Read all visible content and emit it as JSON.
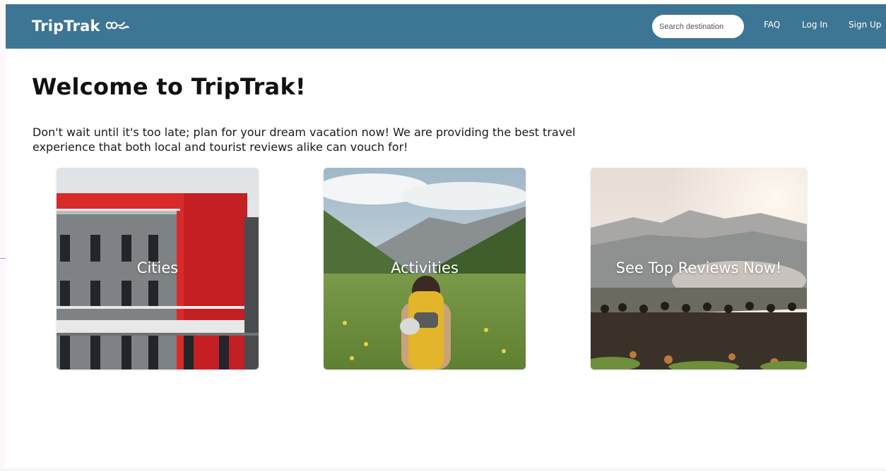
{
  "header": {
    "brand": "TripTrak",
    "search_placeholder": "Search destination",
    "nav": {
      "faq": "FAQ",
      "login": "Log In",
      "signup": "Sign Up"
    }
  },
  "main": {
    "title": "Welcome to TripTrak!",
    "intro": "Don't wait until it's too late; plan for your dream vacation now! We are providing the best travel experience that both local and tourist reviews alike can vouch for!",
    "cards": [
      {
        "label": "Cities"
      },
      {
        "label": "Activities"
      },
      {
        "label": "See Top Reviews Now!"
      }
    ]
  },
  "colors": {
    "navbar": "#3d7594",
    "text": "#111111",
    "background": "#ffffff"
  },
  "icons": [
    "glasses-pointing-hand-logo-icon"
  ]
}
